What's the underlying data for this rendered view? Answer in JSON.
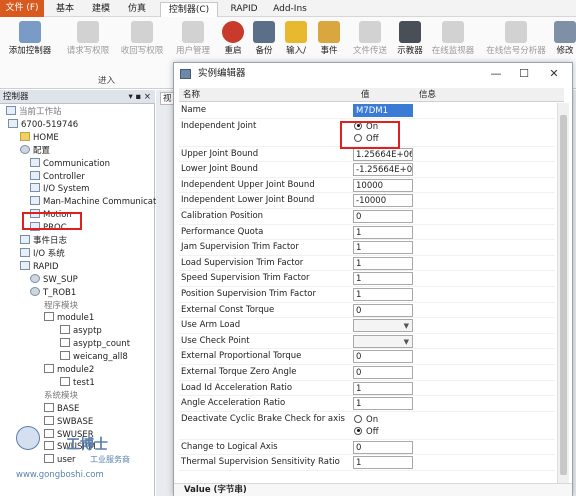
{
  "ribbon": {
    "tabs": [
      "文件 (F)",
      "基本",
      "建模",
      "仿真",
      "控制器(C)",
      "RAPID",
      "Add-Ins"
    ],
    "buttons": [
      {
        "label": "添加控制器",
        "icon": "add-controller-icon",
        "enabled": true
      },
      {
        "label": "请求写权限",
        "icon": "request-write-icon",
        "enabled": false
      },
      {
        "label": "收回写权限",
        "icon": "release-write-icon",
        "enabled": false
      },
      {
        "label": "用户管理",
        "icon": "user-management-icon",
        "enabled": false
      },
      {
        "label": "重启",
        "icon": "restart-icon",
        "enabled": true
      },
      {
        "label": "备份",
        "icon": "backup-icon",
        "enabled": true
      },
      {
        "label": "输入/",
        "icon": "io-icon",
        "enabled": true
      },
      {
        "label": "事件",
        "icon": "event-icon",
        "enabled": true
      },
      {
        "label": "文件传送",
        "icon": "file-transfer-icon",
        "enabled": false
      },
      {
        "label": "示教器",
        "icon": "flexpendant-icon",
        "enabled": true
      },
      {
        "label": "在线监视器",
        "icon": "online-monitor-icon",
        "enabled": false
      },
      {
        "label": "在线信号分析器",
        "icon": "signal-analyzer-icon",
        "enabled": false
      },
      {
        "label": "修改",
        "icon": "edit-icon",
        "enabled": true
      }
    ],
    "group_label": "进入"
  },
  "panel": {
    "title": "控制器",
    "pin": "▾ ▪ ×"
  },
  "tree": [
    {
      "label": "当前工作站",
      "icon": "station-icon",
      "caption": true
    },
    {
      "label": "6700-519746",
      "icon": "controller-icon"
    },
    {
      "label": "HOME",
      "icon": "folder-icon"
    },
    {
      "label": "配置",
      "icon": "config-icon"
    },
    {
      "label": "Communication",
      "icon": "topic-icon"
    },
    {
      "label": "Controller",
      "icon": "topic-icon"
    },
    {
      "label": "I/O System",
      "icon": "topic-icon"
    },
    {
      "label": "Man-Machine Communicatio",
      "icon": "topic-icon"
    },
    {
      "label": "Motion",
      "icon": "topic-icon"
    },
    {
      "label": "PROC",
      "icon": "topic-icon"
    },
    {
      "label": "事件日志",
      "icon": "event-log-icon"
    },
    {
      "label": "I/O 系统",
      "icon": "io-system-icon"
    },
    {
      "label": "RAPID",
      "icon": "rapid-icon"
    },
    {
      "label": "SW_SUP",
      "icon": "task-icon"
    },
    {
      "label": "T_ROB1",
      "icon": "task-icon"
    },
    {
      "label": "程序模块",
      "icon": "",
      "caption": true
    },
    {
      "label": "module1",
      "icon": "module-icon"
    },
    {
      "label": "asyptp",
      "icon": "routine-icon"
    },
    {
      "label": "asyptp_count",
      "icon": "routine-icon"
    },
    {
      "label": "weicang_all8",
      "icon": "routine-icon"
    },
    {
      "label": "module2",
      "icon": "module-icon"
    },
    {
      "label": "test1",
      "icon": "routine-icon"
    },
    {
      "label": "系统模块",
      "icon": "",
      "caption": true
    },
    {
      "label": "BASE",
      "icon": "module-icon"
    },
    {
      "label": "SWBASE",
      "icon": "module-icon"
    },
    {
      "label": "SWUSER",
      "icon": "module-icon"
    },
    {
      "label": "SWUSRM",
      "icon": "module-icon"
    },
    {
      "label": "user",
      "icon": "module-icon"
    }
  ],
  "view_tab": "视",
  "dialog": {
    "title": "实例编辑器",
    "columns": [
      "名称",
      "值",
      "信息"
    ],
    "rows": [
      {
        "name": "Name",
        "type": "text",
        "value": "M7DM1",
        "selected": true
      },
      {
        "name": "Independent Joint",
        "type": "radio",
        "options": [
          "On",
          "Off"
        ],
        "value": "On"
      },
      {
        "name": "Upper Joint Bound",
        "type": "text",
        "value": "1.25664E+06"
      },
      {
        "name": "Lower Joint Bound",
        "type": "text",
        "value": "-1.25664E+06"
      },
      {
        "name": "Independent Upper Joint Bound",
        "type": "text",
        "value": "10000"
      },
      {
        "name": "Independent Lower Joint Bound",
        "type": "text",
        "value": "-10000"
      },
      {
        "name": "Calibration Position",
        "type": "text",
        "value": "0"
      },
      {
        "name": "Performance Quota",
        "type": "text",
        "value": "1"
      },
      {
        "name": "Jam Supervision Trim Factor",
        "type": "text",
        "value": "1"
      },
      {
        "name": "Load Supervision Trim Factor",
        "type": "text",
        "value": "1"
      },
      {
        "name": "Speed Supervision Trim Factor",
        "type": "text",
        "value": "1"
      },
      {
        "name": "Position Supervision Trim Factor",
        "type": "text",
        "value": "1"
      },
      {
        "name": "External Const Torque",
        "type": "text",
        "value": "0"
      },
      {
        "name": "Use Arm Load",
        "type": "select",
        "value": ""
      },
      {
        "name": "Use Check Point",
        "type": "select",
        "value": ""
      },
      {
        "name": "External Proportional Torque",
        "type": "text",
        "value": "0"
      },
      {
        "name": "External Torque Zero Angle",
        "type": "text",
        "value": "0"
      },
      {
        "name": "Load Id Acceleration Ratio",
        "type": "text",
        "value": "1"
      },
      {
        "name": "Angle Acceleration Ratio",
        "type": "text",
        "value": "1"
      },
      {
        "name": "Deactivate Cyclic Brake Check for axis",
        "type": "radio",
        "options": [
          "On",
          "Off"
        ],
        "value": "Off"
      },
      {
        "name": "Change to Logical Axis",
        "type": "text",
        "value": "0"
      },
      {
        "name": "Thermal Supervision Sensitivity Ratio",
        "type": "text",
        "value": "1"
      }
    ],
    "desc_label": "Value (字节串)"
  },
  "watermark": {
    "line1": "工博士",
    "line2": "工业服务商",
    "line3": "www.gongboshi.com"
  },
  "colors": {
    "file_tab": "#d85a1f",
    "highlight": "#e02020",
    "selection": "#3a7bd5"
  }
}
